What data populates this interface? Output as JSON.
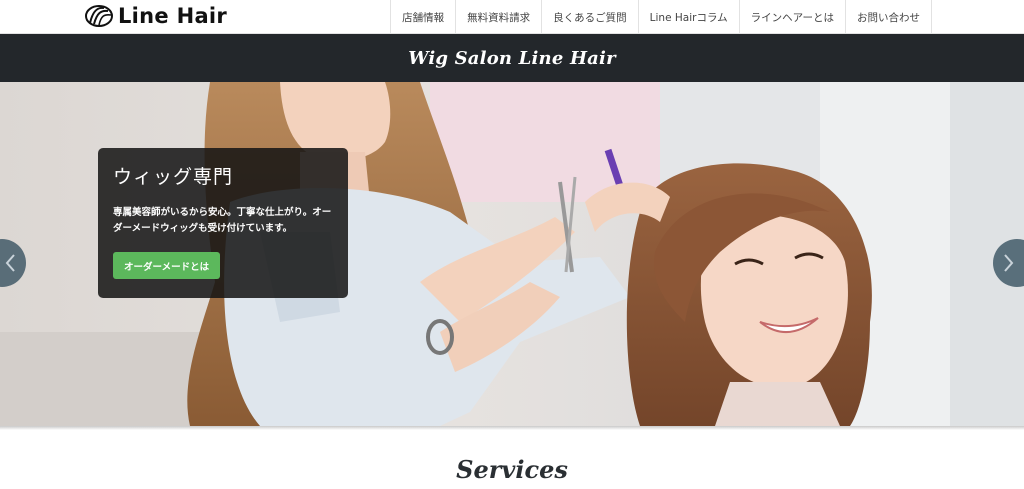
{
  "header": {
    "logo_text": "Line Hair",
    "nav": [
      {
        "label": "店舗情報"
      },
      {
        "label": "無料資料請求"
      },
      {
        "label": "良くあるご質問"
      },
      {
        "label": "Line Hairコラム"
      },
      {
        "label": "ラインヘアーとは"
      },
      {
        "label": "お問い合わせ"
      }
    ]
  },
  "titlebar": {
    "title": "Wig Salon Line Hair"
  },
  "hero": {
    "caption_title": "ウィッグ専門",
    "caption_text": "専属美容師がいるから安心。丁寧な仕上がり。オーダーメードウィッグも受け付けています。",
    "cta_label": "オーダーメードとは",
    "prev_icon": "chevron-left-icon",
    "next_icon": "chevron-right-icon"
  },
  "services": {
    "heading": "Services"
  },
  "colors": {
    "titlebar_bg": "#23272b",
    "cta_green": "#5cb85c",
    "caption_bg": "#141414",
    "arrow_bg": "#3c5564"
  }
}
